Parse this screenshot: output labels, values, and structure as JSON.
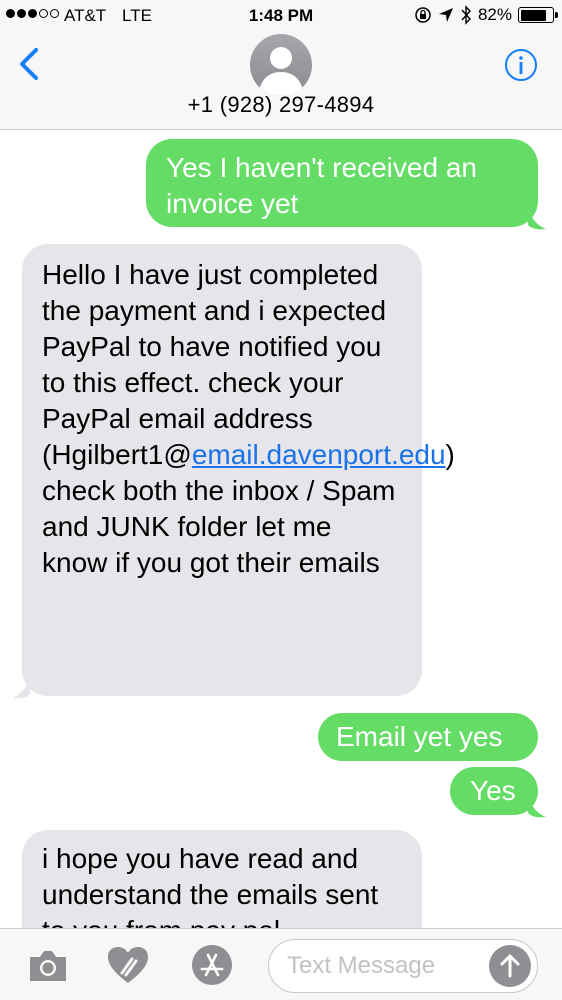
{
  "status_bar": {
    "carrier": "AT&T",
    "network": "LTE",
    "time": "1:48 PM",
    "battery_percent": "82%",
    "battery_level": 0.82
  },
  "header": {
    "contact_number": "+1 (928) 297-4894",
    "back_icon": "chevron-left-icon",
    "info_icon": "info-icon"
  },
  "messages": [
    {
      "from": "me",
      "text": "Yes I haven't received an invoice yet"
    },
    {
      "from": "them",
      "text_before_link": "Hello I have just completed the payment and i expected PayPal to have notified you to this effect. check your PayPal email address (Hgilbert1@",
      "link": "email.davenport.edu",
      "text_after_link": ") check both the inbox / Spam and JUNK folder let me know if you got their emails"
    },
    {
      "from": "me",
      "text": "Email yet yes"
    },
    {
      "from": "me",
      "text": "Yes"
    },
    {
      "from": "them",
      "text": "i hope you have read and understand the emails sent to you from pay pal"
    }
  ],
  "input_bar": {
    "placeholder": "Text Message",
    "icons": [
      "camera-icon",
      "digital-touch-icon",
      "app-store-icon",
      "microphone-icon"
    ]
  },
  "colors": {
    "sent_bubble": "#65dc66",
    "received_bubble": "#e5e5ea",
    "accent": "#1a73e8",
    "ios_blue": "#147efb"
  }
}
